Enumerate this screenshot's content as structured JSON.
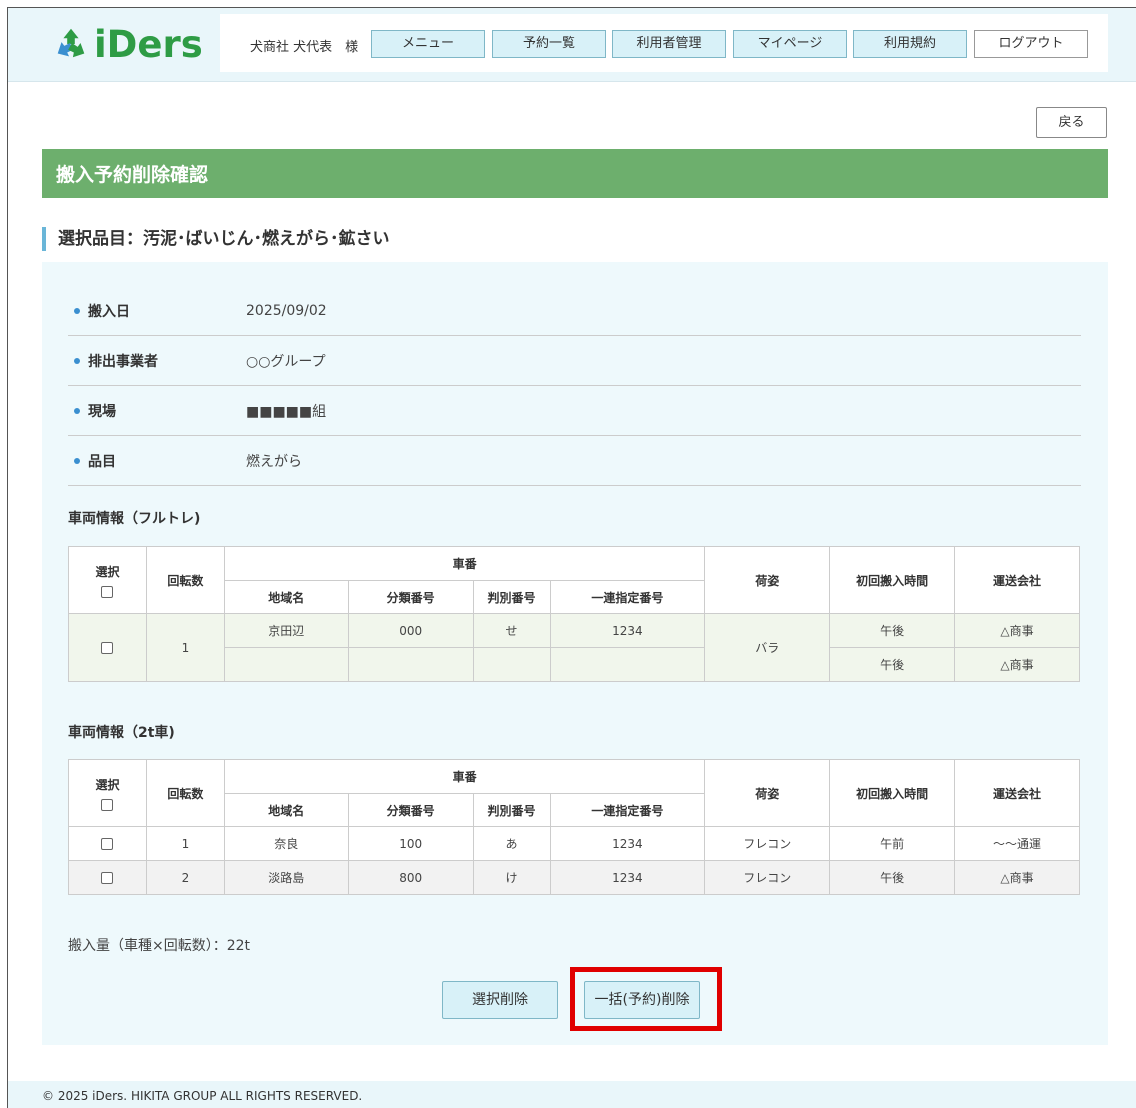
{
  "brand": {
    "logo_text": "iDers",
    "logo_color": "#2e9c45"
  },
  "header": {
    "user": "犬商社 犬代表　様",
    "nav": [
      "メニュー",
      "予約一覧",
      "利用者管理",
      "マイページ",
      "利用規約"
    ],
    "logout": "ログアウト"
  },
  "back_label": "戻る",
  "page_title": "搬入予約削除確認",
  "selected_item": "選択品目：汚泥･ばいじん･燃えがら･鉱さい",
  "info": [
    {
      "label": "搬入日",
      "value": "2025/09/02"
    },
    {
      "label": "排出事業者",
      "value": "○○グループ"
    },
    {
      "label": "現場",
      "value": "■■■■■組"
    },
    {
      "label": "品目",
      "value": "燃えがら"
    }
  ],
  "table_headers": {
    "select": "選択",
    "rotation": "回転数",
    "plate": "車番",
    "region": "地域名",
    "class_no": "分類番号",
    "kana": "判別番号",
    "serial": "一連指定番号",
    "packing": "荷姿",
    "first_time": "初回搬入時間",
    "carrier": "運送会社"
  },
  "full_trailer": {
    "title": "車両情報（フルトレ)",
    "row": {
      "rotation": "1",
      "region": "京田辺",
      "class_no": "000",
      "kana": "せ",
      "serial": "1234",
      "packing": "バラ",
      "times": [
        "午後",
        "午後"
      ],
      "carriers": [
        "△商事",
        "△商事"
      ]
    }
  },
  "two_ton": {
    "title": "車両情報（2t車)",
    "rows": [
      {
        "rotation": "1",
        "region": "奈良",
        "class_no": "100",
        "kana": "あ",
        "serial": "1234",
        "packing": "フレコン",
        "time": "午前",
        "carrier": "～～通運"
      },
      {
        "rotation": "2",
        "region": "淡路島",
        "class_no": "800",
        "kana": "け",
        "serial": "1234",
        "packing": "フレコン",
        "time": "午後",
        "carrier": "△商事"
      }
    ]
  },
  "amount_text": "搬入量（車種×回転数）：22t",
  "buttons": {
    "select_delete": "選択削除",
    "bulk_delete": "一括(予約)削除"
  },
  "footer": "© 2025 iDers. HIKITA GROUP ALL RIGHTS RESERVED.",
  "colors": {
    "title_bar": "#6daf6d",
    "panel": "#eef9fc",
    "nav_btn": "#d8f1f8",
    "highlight": "#e00000"
  }
}
